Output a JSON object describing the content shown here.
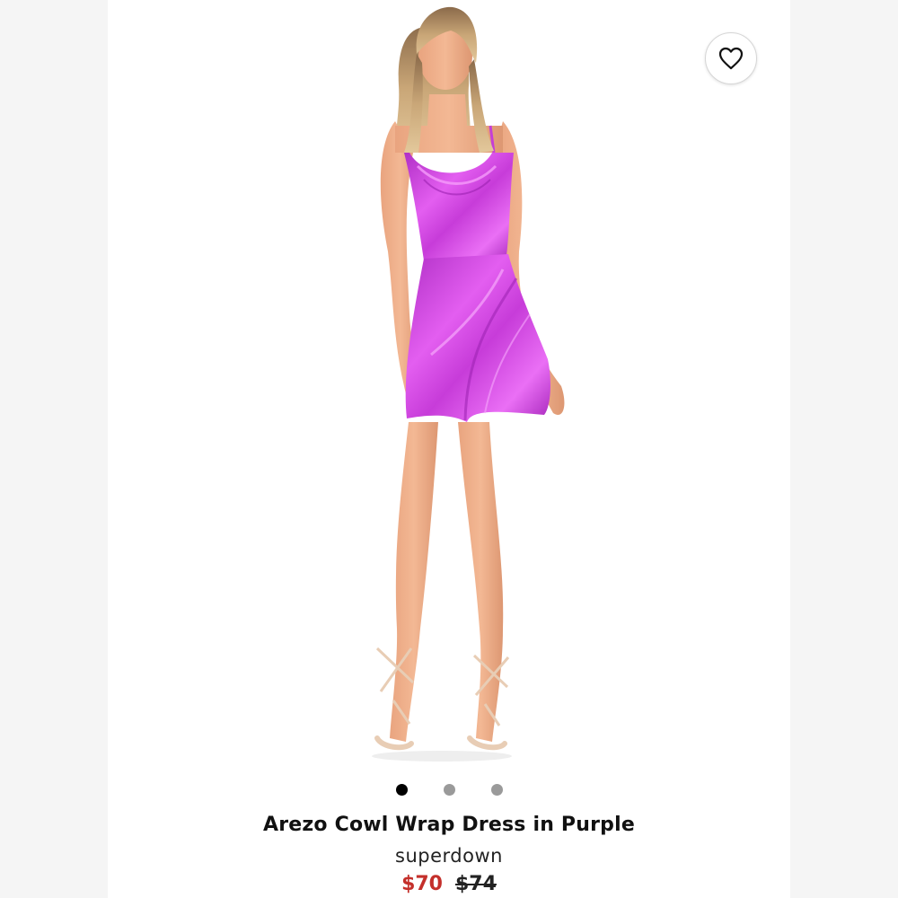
{
  "product": {
    "title": "Arezo Cowl Wrap Dress in Purple",
    "brand": "superdown",
    "sale_price": "$70",
    "original_price": "$74"
  },
  "gallery": {
    "image_count": 3,
    "active_index": 0,
    "dress_color": "#c53ed6"
  },
  "icons": {
    "favorite": "heart-outline-icon"
  },
  "colors": {
    "sale_price": "#c4302b",
    "active_dot": "#000000",
    "inactive_dot": "#9a9a9a"
  }
}
